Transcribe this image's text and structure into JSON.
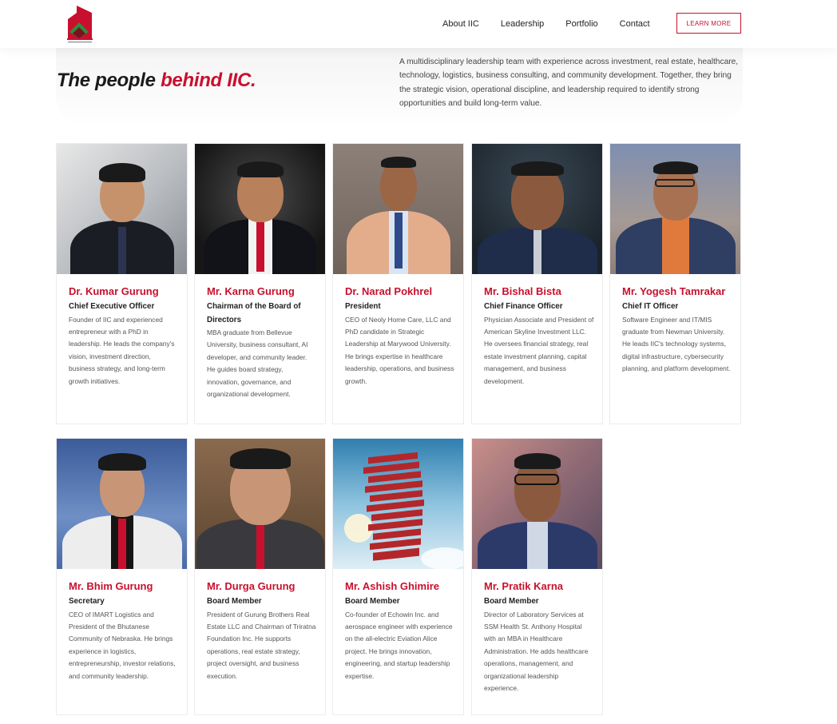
{
  "nav": {
    "items": [
      "About IIC",
      "Leadership",
      "Portfolio",
      "Contact"
    ],
    "cta": "LEARN MORE"
  },
  "hero": {
    "title_main": "The people ",
    "title_accent": "behind IIC.",
    "intro": "A multidisciplinary leadership team with experience across investment, real estate, healthcare, technology, logistics, business consulting, and community development. Together, they bring the strategic vision, operational discipline, and leadership required to identify strong opportunities and build long-term value."
  },
  "colors": {
    "accent": "#c8102e",
    "text": "#222222",
    "muted": "#555555"
  },
  "team": [
    {
      "name": "Dr. Kumar Gurung",
      "role": "Chief Executive Officer",
      "bio": "Founder of IIC and experienced entrepreneur with a PhD in leadership. He leads the company's vision, investment direction, business strategy, and long-term growth initiatives."
    },
    {
      "name": "Mr. Karna Gurung",
      "role": "Chairman of the Board of Directors",
      "bio": "MBA graduate from Bellevue University, business consultant, AI developer, and community leader. He guides board strategy, innovation, governance, and organizational development."
    },
    {
      "name": "Dr. Narad Pokhrel",
      "role": "President",
      "bio": "CEO of Neoly Home Care, LLC and PhD candidate in Strategic Leadership at Marywood University. He brings expertise in healthcare leadership, operations, and business growth."
    },
    {
      "name": "Mr. Bishal Bista",
      "role": "Chief Finance Officer",
      "bio": "Physician Associate and President of American Skyline Investment LLC. He oversees financial strategy, real estate investment planning, capital management, and business development."
    },
    {
      "name": "Mr. Yogesh Tamrakar",
      "role": "Chief IT Officer",
      "bio": "Software Engineer and IT/MIS graduate from Newman University. He leads IIC's technology systems, digital infrastructure, cybersecurity planning, and platform development."
    },
    {
      "name": "Mr. Bhim Gurung",
      "role": "Secretary",
      "bio": "CEO of IMART Logistics and President of the Bhutanese Community of Nebraska. He brings experience in logistics, entrepreneurship, investor relations, and community leadership."
    },
    {
      "name": "Mr. Durga Gurung",
      "role": "Board Member",
      "bio": "President of Gurung Brothers Real Estate LLC and Chairman of Triratna Foundation Inc. He supports operations, real estate strategy, project oversight, and business execution."
    },
    {
      "name": "Mr. Ashish Ghimire",
      "role": "Board Member",
      "bio": "Co-founder of Echowin Inc. and aerospace engineer with experience on the all-electric Eviation Alice project. He brings innovation, engineering, and startup leadership expertise."
    },
    {
      "name": "Mr. Pratik Karna",
      "role": "Board Member",
      "bio": "Director of Laboratory Services at SSM Health St. Anthony Hospital with an MBA in Healthcare Administration. He adds healthcare operations, management, and organizational leadership experience."
    }
  ]
}
